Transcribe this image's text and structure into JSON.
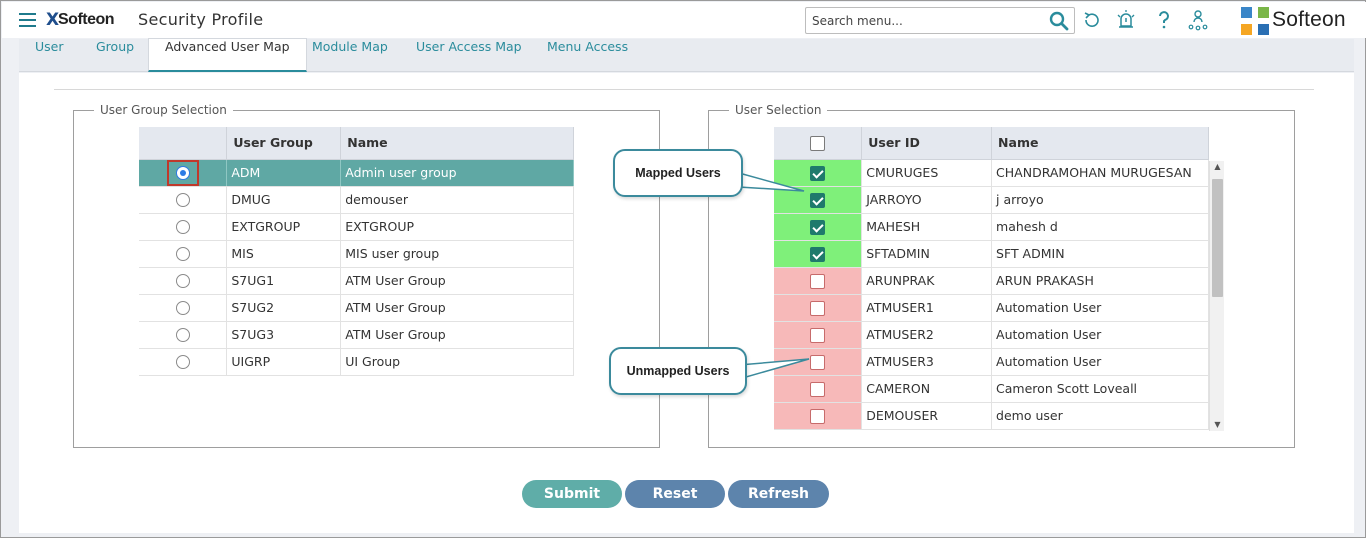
{
  "header": {
    "logo_mark": "X",
    "logo_word": "Softeon",
    "title": "Security Profile",
    "search_placeholder": "Search menu...",
    "brand_word": "Softeon"
  },
  "tabs": [
    {
      "label": "User"
    },
    {
      "label": "Group"
    },
    {
      "label": "Advanced User Map"
    },
    {
      "label": "Module Map"
    },
    {
      "label": "User Access Map"
    },
    {
      "label": "Menu Access"
    }
  ],
  "active_tab": "Advanced User Map",
  "group_panel": {
    "legend": "User Group Selection",
    "columns": [
      "",
      "User Group",
      "Name"
    ],
    "rows": [
      {
        "code": "ADM",
        "name": "Admin user group",
        "selected": true
      },
      {
        "code": "DMUG",
        "name": "demouser",
        "selected": false
      },
      {
        "code": "EXTGROUP",
        "name": "EXTGROUP",
        "selected": false
      },
      {
        "code": "MIS",
        "name": "MIS user group",
        "selected": false
      },
      {
        "code": "S7UG1",
        "name": "ATM User Group",
        "selected": false
      },
      {
        "code": "S7UG2",
        "name": "ATM User Group",
        "selected": false
      },
      {
        "code": "S7UG3",
        "name": "ATM User Group",
        "selected": false
      },
      {
        "code": "UIGRP",
        "name": "UI Group",
        "selected": false
      }
    ]
  },
  "user_panel": {
    "legend": "User Selection",
    "columns": [
      "",
      "User ID",
      "Name"
    ],
    "rows": [
      {
        "user_id": "CMURUGES",
        "name": "CHANDRAMOHAN MURUGESAN",
        "checked": true
      },
      {
        "user_id": "JARROYO",
        "name": "j arroyo",
        "checked": true
      },
      {
        "user_id": "MAHESH",
        "name": "mahesh d",
        "checked": true
      },
      {
        "user_id": "SFTADMIN",
        "name": "SFT ADMIN",
        "checked": true
      },
      {
        "user_id": "ARUNPRAK",
        "name": "ARUN PRAKASH",
        "checked": false
      },
      {
        "user_id": "ATMUSER1",
        "name": "Automation User",
        "checked": false
      },
      {
        "user_id": "ATMUSER2",
        "name": "Automation User",
        "checked": false
      },
      {
        "user_id": "ATMUSER3",
        "name": "Automation User",
        "checked": false
      },
      {
        "user_id": "CAMERON",
        "name": "Cameron Scott Loveall",
        "checked": false
      },
      {
        "user_id": "DEMOUSER",
        "name": "demo user",
        "checked": false
      }
    ]
  },
  "callouts": {
    "mapped": "Mapped Users",
    "unmapped": "Unmapped Users"
  },
  "buttons": {
    "submit": "Submit",
    "reset": "Reset",
    "refresh": "Refresh"
  },
  "icons": [
    "menu-icon",
    "search-icon",
    "refresh-icon",
    "alarm-icon",
    "help-icon",
    "user-network-icon"
  ],
  "colors": {
    "accent": "#2a8c9c",
    "selected_row": "#5fa8a4",
    "mapped_highlight": "#7ff07a",
    "unmapped_highlight": "#f7b9b9",
    "submit": "#5fada8",
    "secondary_button": "#5d84ac"
  }
}
